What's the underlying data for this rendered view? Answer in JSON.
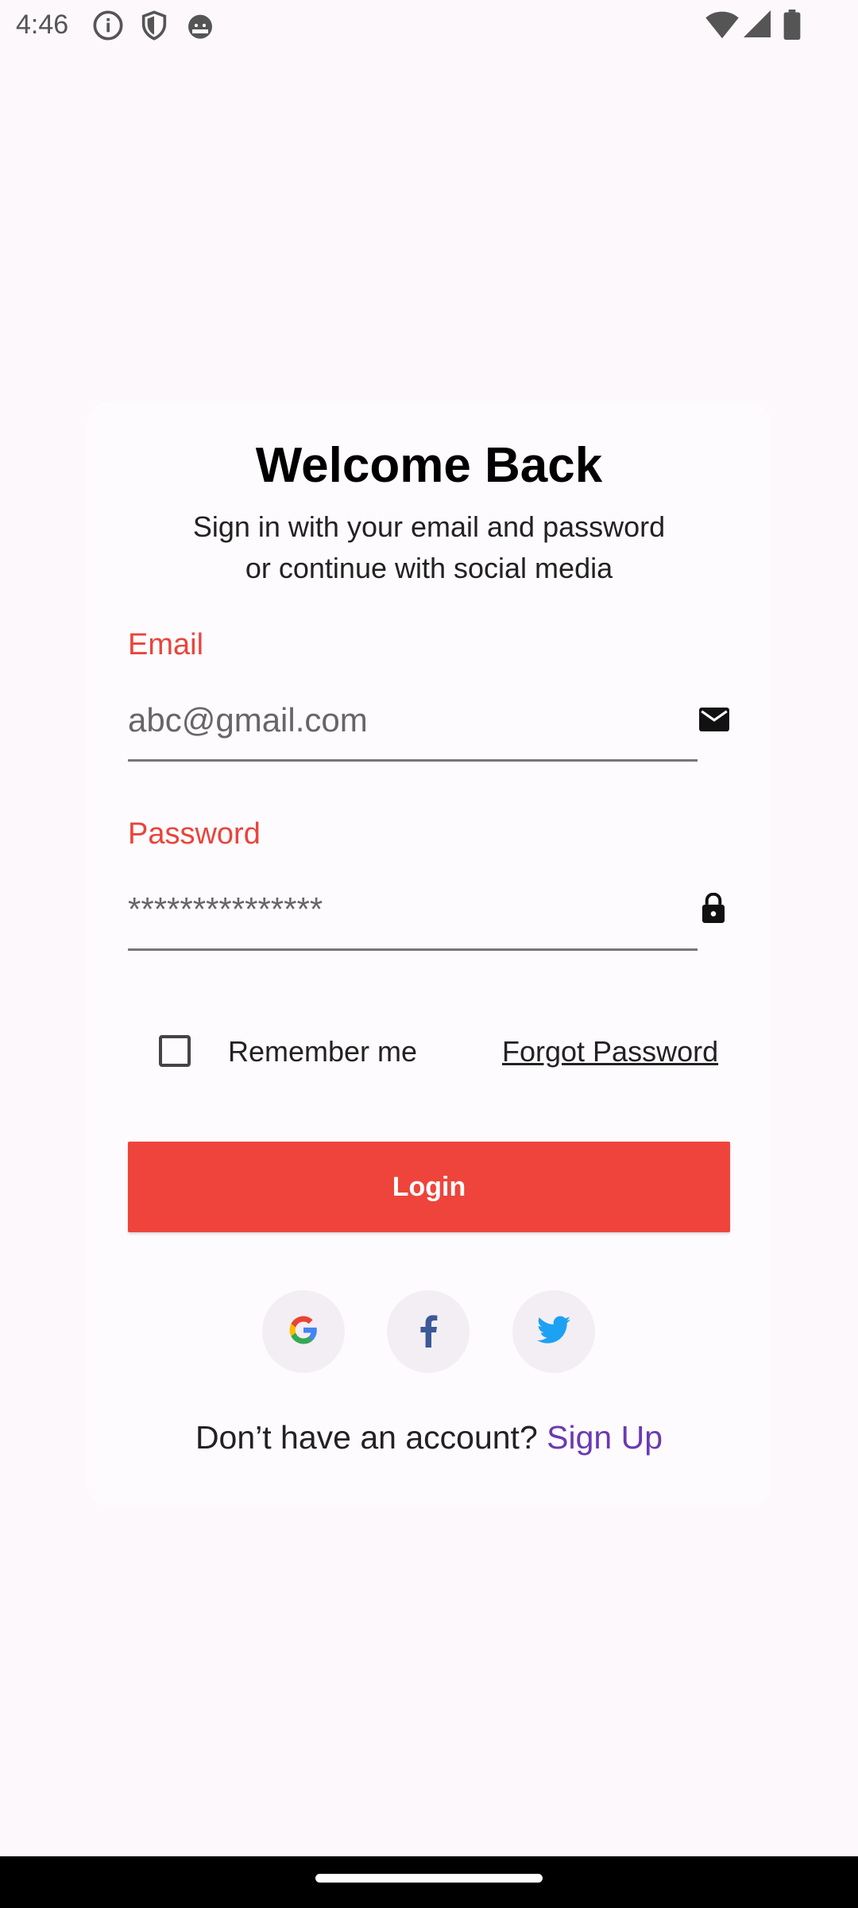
{
  "status_bar": {
    "time": "4:46",
    "left_icons": [
      "info-icon",
      "shield-icon",
      "android-icon"
    ],
    "right_icons": [
      "wifi-icon",
      "signal-icon",
      "battery-icon"
    ]
  },
  "login": {
    "title": "Welcome Back",
    "subtitle_line1": "Sign in with your email and password",
    "subtitle_line2": "or continue with social media",
    "email": {
      "label": "Email",
      "value": "abc@gmail.com",
      "icon": "mail-icon"
    },
    "password": {
      "label": "Password",
      "value": "***************",
      "icon": "lock-icon"
    },
    "remember_label": "Remember me",
    "remember_checked": false,
    "forgot_label": "Forgot Password",
    "login_label": "Login",
    "social": [
      "google-icon",
      "facebook-icon",
      "twitter-icon"
    ],
    "no_account_text": "Don’t have an account? ",
    "signup_label": "Sign Up"
  },
  "colors": {
    "accent": "#ee443b",
    "label": "#e8453c",
    "link": "#6a3ab2",
    "background": "#fdf8fc"
  }
}
